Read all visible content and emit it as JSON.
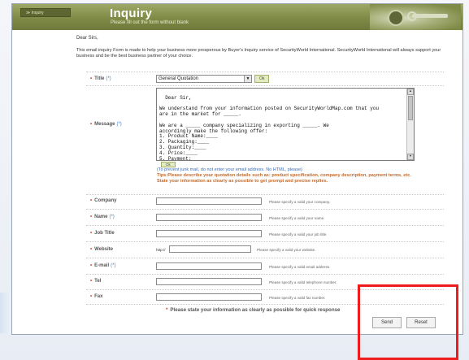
{
  "header": {
    "tab_label": "≫ Inquiry",
    "title": "Inquiry",
    "subtitle": "Please fill out the form without blank"
  },
  "greeting": "Dear Sirs,",
  "intro": "This email inquiry Form is made to help your business more prosperous by Buyer's Inquiry service of SecurityWorld International. SecurityWorld International will always support your business and be the best business partner of your choice.",
  "title_field": {
    "label": "Title",
    "required_mark": "(*)",
    "selected": "General Quotation",
    "ok_label": "Ok"
  },
  "message_field": {
    "label": "Message",
    "required_mark": "(*)",
    "value": "Dear Sir,\n\nWe understand from your information posted on SecurityWorldMap.com that you\nare in the market for _____.\n\nWe are a _____ company specializing in exporting _____. We\naccordingly make the following offer:\n1. Product Name:____\n2. Packaging:____\n3. Quantity:____\n4. Price:____\n5. Payment:____",
    "ok_label": "Ok",
    "junk_note": "(To prevent junk mail, do not enter your email address. No HTML, please)",
    "tips": "Tips:Please describe your quotation details such as: product specification, company description, payment terms, etc. State your information as clearly as possible to get prompt and precise replies."
  },
  "fields": [
    {
      "label": "Company",
      "required_mark": "",
      "value": "",
      "hint": "Please specify a valid your company."
    },
    {
      "label": "Name",
      "required_mark": "(*)",
      "value": "",
      "hint": "Please specify a valid your name."
    },
    {
      "label": "Job Title",
      "required_mark": "",
      "value": "",
      "hint": "Please specify a valid your job title."
    },
    {
      "label": "Website",
      "required_mark": "",
      "prefix": "http://",
      "value": "",
      "hint": "Please specify a valid your website."
    },
    {
      "label": "E-mail",
      "required_mark": "(*)",
      "value": "",
      "hint": "Please specify a valid email address."
    },
    {
      "label": "Tel",
      "required_mark": "",
      "value": "",
      "hint": "Please specify a valid telephone number."
    },
    {
      "label": "Fax",
      "required_mark": "",
      "value": "",
      "hint": "Please specify a valid fax number."
    }
  ],
  "bottom_note": "Please state your information as clearly as possible for quick response",
  "buttons": {
    "send": "Send",
    "reset": "Reset"
  },
  "colors": {
    "header": "#7e8a46",
    "annotation": "#ee1c1c",
    "tips": "#c46a2a",
    "link": "#3a6db8"
  }
}
